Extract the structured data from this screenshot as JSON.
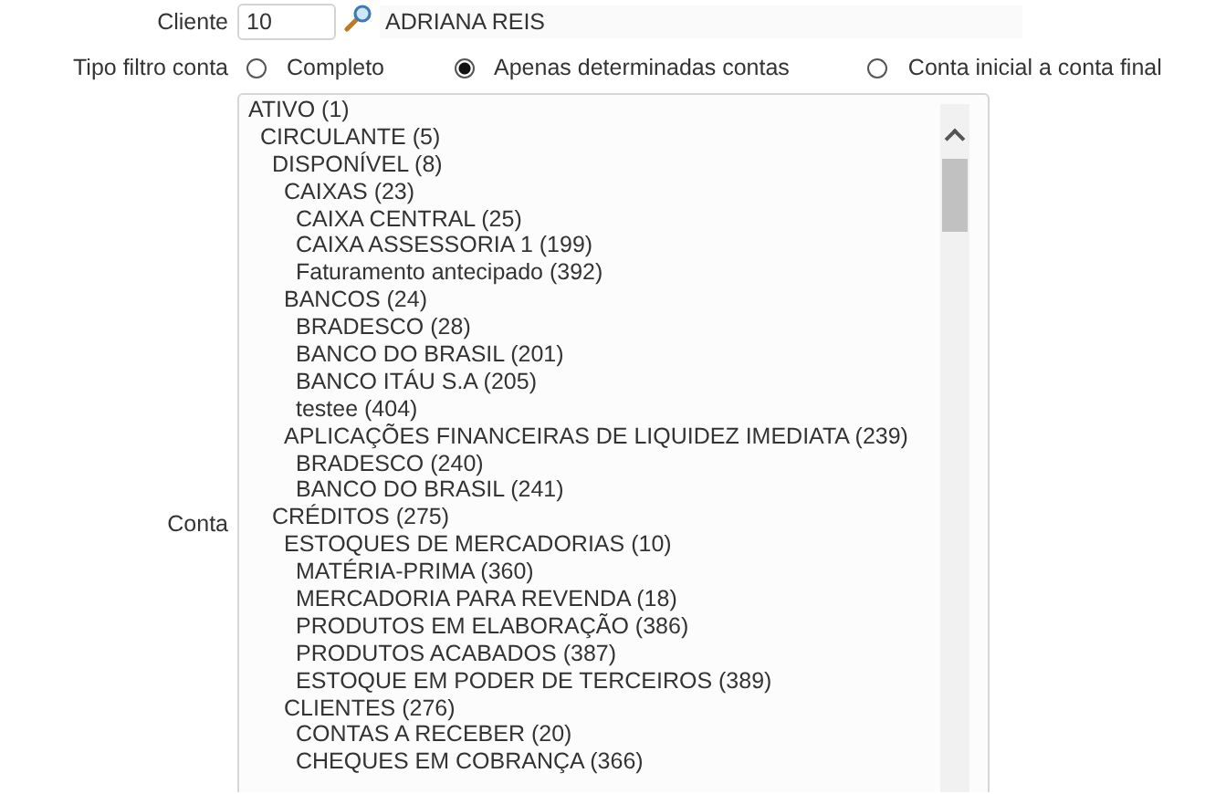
{
  "client": {
    "label": "Cliente",
    "code": "10",
    "name": "ADRIANA REIS"
  },
  "filter_type": {
    "label": "Tipo filtro conta",
    "options": [
      {
        "label": "Completo",
        "selected": false
      },
      {
        "label": "Apenas determinadas contas",
        "selected": true
      },
      {
        "label": "Conta inicial a conta final",
        "selected": false
      }
    ]
  },
  "account": {
    "label": "Conta",
    "tree": [
      {
        "label": "ATIVO (1)",
        "children": [
          {
            "label": "CIRCULANTE (5)",
            "children": [
              {
                "label": "DISPONÍVEL (8)",
                "children": [
                  {
                    "label": "CAIXAS (23)",
                    "children": [
                      {
                        "label": "CAIXA CENTRAL (25)"
                      },
                      {
                        "label": "CAIXA ASSESSORIA 1 (199)"
                      },
                      {
                        "label": "Faturamento antecipado (392)"
                      }
                    ]
                  },
                  {
                    "label": "BANCOS (24)",
                    "children": [
                      {
                        "label": "BRADESCO (28)"
                      },
                      {
                        "label": "BANCO DO BRASIL (201)"
                      },
                      {
                        "label": "BANCO ITÁU S.A (205)"
                      },
                      {
                        "label": "testee (404)"
                      }
                    ]
                  },
                  {
                    "label": "APLICAÇÕES FINANCEIRAS DE LIQUIDEZ IMEDIATA (239)",
                    "children": [
                      {
                        "label": "BRADESCO (240)"
                      },
                      {
                        "label": "BANCO DO BRASIL (241)"
                      }
                    ]
                  }
                ]
              },
              {
                "label": "CRÉDITOS (275)",
                "children": [
                  {
                    "label": "ESTOQUES DE MERCADORIAS (10)",
                    "children": [
                      {
                        "label": "MATÉRIA-PRIMA (360)"
                      },
                      {
                        "label": "MERCADORIA PARA REVENDA (18)"
                      },
                      {
                        "label": "PRODUTOS EM ELABORAÇÃO (386)"
                      },
                      {
                        "label": "PRODUTOS ACABADOS (387)"
                      },
                      {
                        "label": "ESTOQUE EM PODER DE TERCEIROS (389)"
                      }
                    ]
                  },
                  {
                    "label": "CLIENTES (276)",
                    "children": [
                      {
                        "label": "CONTAS A RECEBER (20)"
                      },
                      {
                        "label": "CHEQUES EM COBRANÇA (366)"
                      }
                    ]
                  }
                ]
              }
            ]
          }
        ]
      }
    ]
  }
}
